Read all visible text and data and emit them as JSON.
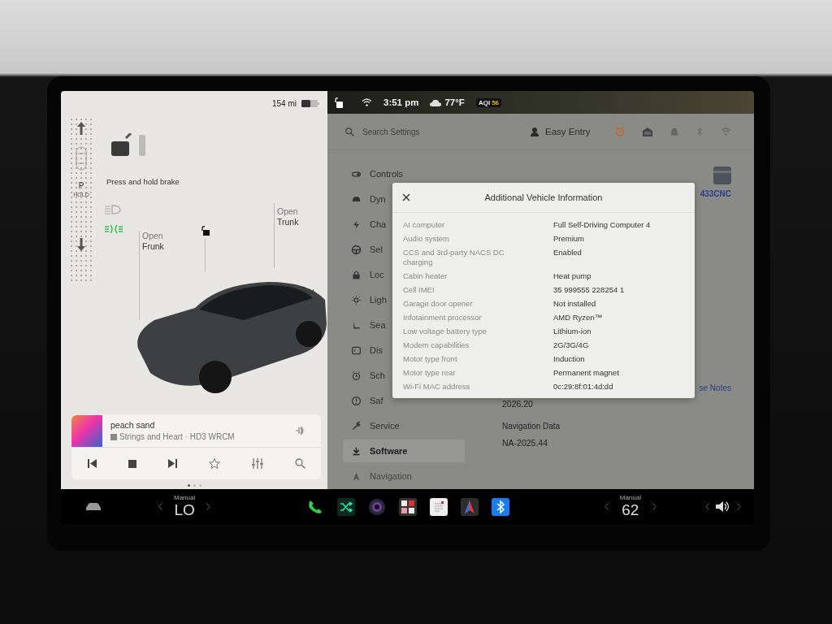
{
  "left_panel": {
    "range": "154 mi",
    "brake_hint": "Press and hold brake",
    "gear": {
      "label": "P",
      "sublabel": "HOLD"
    },
    "lights": [
      {
        "kind": "auto-headlight",
        "on": false
      },
      {
        "kind": "parking-light",
        "on": true
      }
    ],
    "frunk": {
      "line1": "Open",
      "line2": "Frunk"
    },
    "trunk": {
      "line1": "Open",
      "line2": "Trunk"
    }
  },
  "media": {
    "title": "peach sand",
    "station": "Strings and Heart · HD3 WRCM"
  },
  "page_dots": [
    {
      "selected": true
    },
    {
      "selected": false
    },
    {
      "selected": false
    }
  ],
  "status_bar": {
    "time": "3:51 pm",
    "temperature": "77°F",
    "aqi_label": "AQI",
    "aqi_value": "56"
  },
  "settings": {
    "search": {
      "placeholder": "Search Settings"
    },
    "profile": "Easy Entry",
    "sidebar": {
      "items": [
        {
          "label": "Controls",
          "selected": false
        },
        {
          "label": "Dyn",
          "selected": false
        },
        {
          "label": "Cha",
          "selected": false
        },
        {
          "label": "Sel",
          "selected": false
        },
        {
          "label": "Loc",
          "selected": false
        },
        {
          "label": "Ligh",
          "selected": false
        },
        {
          "label": "Sea",
          "selected": false
        },
        {
          "label": "Dis",
          "selected": false
        },
        {
          "label": "Sch",
          "selected": false
        },
        {
          "label": "Saf",
          "selected": false
        },
        {
          "label": "Service",
          "selected": false
        },
        {
          "label": "Software",
          "selected": true
        },
        {
          "label": "Navigation",
          "selected": false
        }
      ]
    },
    "content": {
      "vehicle_id": "433CNC",
      "release_notes_link": "se Notes",
      "version": "2026.20",
      "nav_heading": "Navigation Data",
      "nav_version": "NA-2025.44"
    }
  },
  "modal": {
    "title": "Additional Vehicle Information",
    "rows": [
      {
        "label": "AI computer",
        "value": "Full Self-Driving Computer 4"
      },
      {
        "label": "Audio system",
        "value": "Premium"
      },
      {
        "label": "CCS and 3rd-party NACS DC charging",
        "value": "Enabled"
      },
      {
        "label": "Cabin heater",
        "value": "Heat pump"
      },
      {
        "label": "Cell IMEI",
        "value": "35 999555 228254 1"
      },
      {
        "label": "Garage door opener",
        "value": "Not installed"
      },
      {
        "label": "Infotainment processor",
        "value": "AMD Ryzen™"
      },
      {
        "label": "Low voltage battery type",
        "value": "Lithium-ion"
      },
      {
        "label": "Modem capabilities",
        "value": "2G/3G/4G"
      },
      {
        "label": "Motor type front",
        "value": "Induction"
      },
      {
        "label": "Motor type rear",
        "value": "Permanent magnet"
      },
      {
        "label": "Wi-Fi MAC address",
        "value": "0c:29:8f:01:4d:dd"
      }
    ]
  },
  "bottom_bar": {
    "left_climate": {
      "mode": "Manual",
      "value": "LO"
    },
    "right_climate": {
      "mode": "Manual",
      "value": "62"
    },
    "apps": [
      {
        "kind": "phone"
      },
      {
        "kind": "shuffle"
      },
      {
        "kind": "camera"
      },
      {
        "kind": "apps"
      },
      {
        "kind": "notepad"
      },
      {
        "kind": "navigation"
      },
      {
        "kind": "bluetooth"
      }
    ]
  }
}
